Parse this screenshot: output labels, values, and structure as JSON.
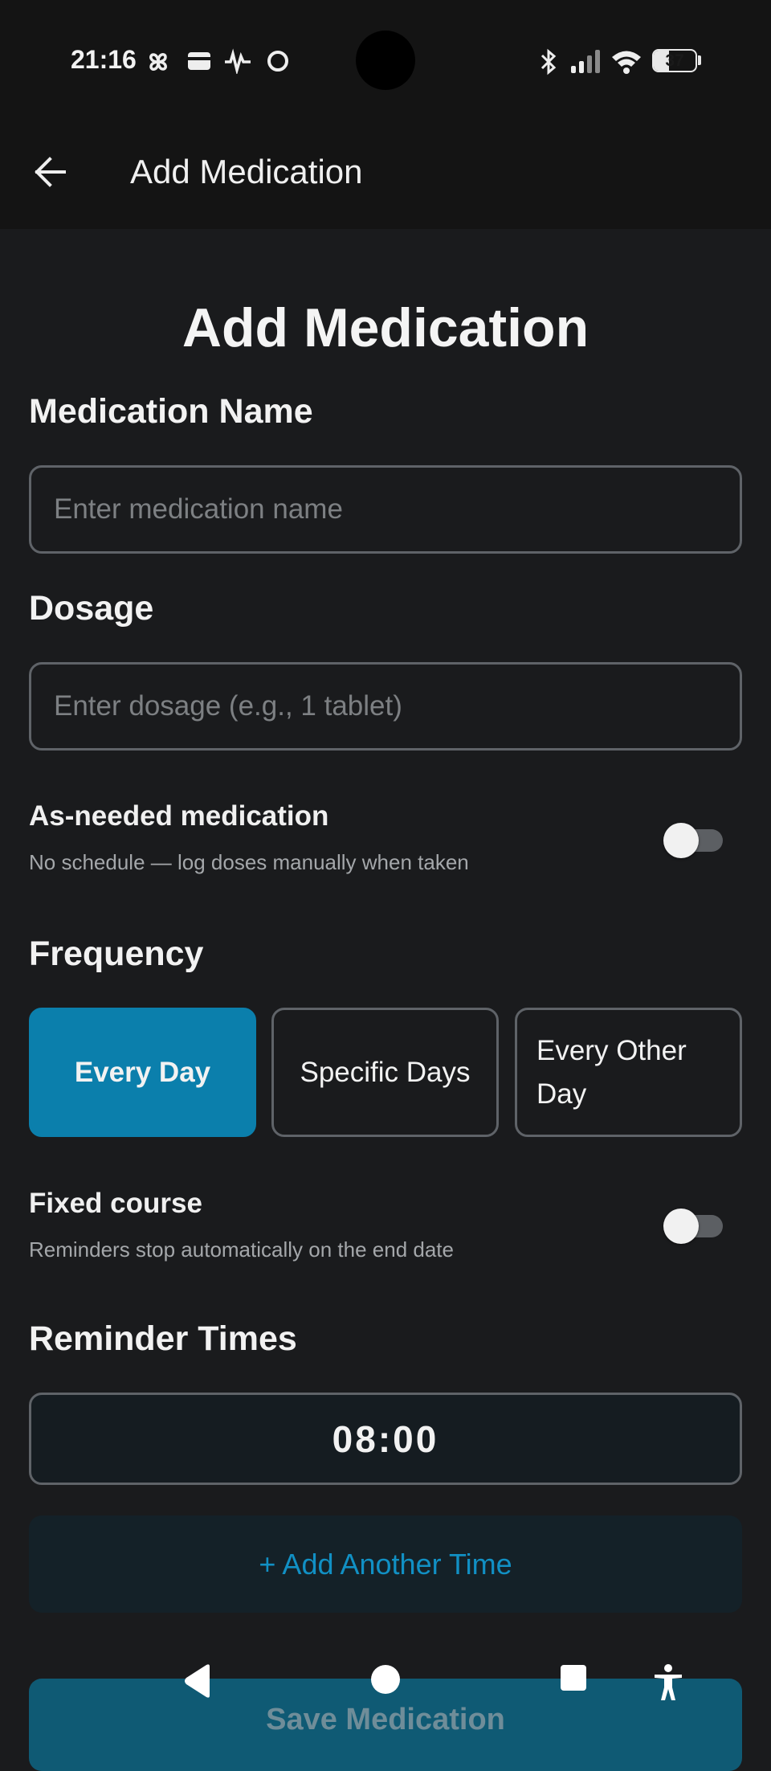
{
  "status_bar": {
    "time": "21:16",
    "battery": "37",
    "battery_level": 0.37,
    "icons": [
      "pinwheel-icon",
      "wallet-icon",
      "activity-icon",
      "circle-icon",
      "bluetooth-icon",
      "signal-icon",
      "wifi-icon",
      "battery-icon"
    ]
  },
  "app_bar": {
    "title": "Add Medication",
    "back_icon": "arrow-left-icon"
  },
  "form": {
    "heading": "Add Medication",
    "medication_name": {
      "label": "Medication Name",
      "placeholder": "Enter medication name",
      "value": ""
    },
    "dosage": {
      "label": "Dosage",
      "placeholder": "Enter dosage (e.g., 1 tablet)",
      "value": ""
    },
    "as_needed": {
      "title": "As-needed medication",
      "subtitle": "No schedule — log doses manually when taken",
      "enabled": false
    },
    "frequency": {
      "label": "Frequency",
      "options": [
        "Every Day",
        "Specific Days",
        "Every Other Day"
      ],
      "selected": "Every Day"
    },
    "fixed_course": {
      "title": "Fixed course",
      "subtitle": "Reminders stop automatically on the end date",
      "enabled": false
    },
    "reminder_times": {
      "label": "Reminder Times",
      "times": [
        "08:00"
      ]
    },
    "add_time_label": "+ Add Another Time",
    "save_label": "Save Medication"
  },
  "colors": {
    "background": "#1a1b1d",
    "accent": "#0b7fac",
    "accent_text": "#1190c4",
    "border": "#5f6368"
  },
  "nav_bar": {
    "icons": [
      "back-triangle-icon",
      "home-circle-icon",
      "recents-square-icon",
      "accessibility-icon"
    ]
  }
}
